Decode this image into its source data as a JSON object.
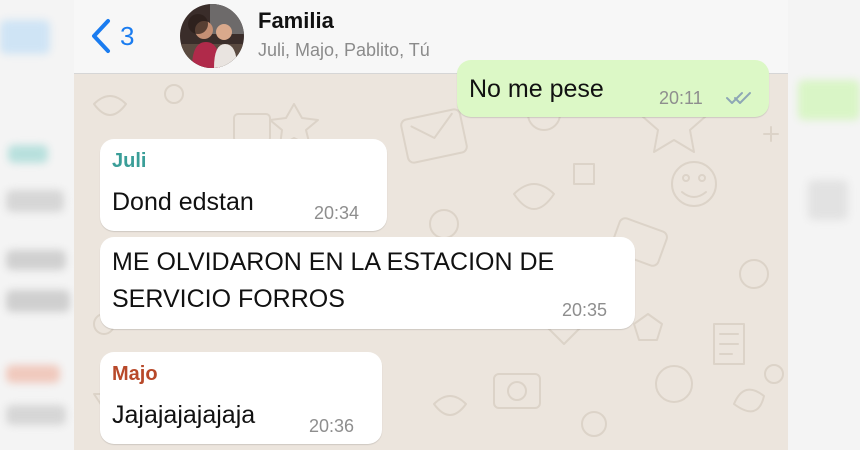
{
  "header": {
    "back_count": "3",
    "chat_title": "Familia",
    "members": "Juli, Majo, Pablito, Tú"
  },
  "colors": {
    "ios_blue": "#1a7cf0",
    "chat_background": "#ece5dd",
    "outgoing_bubble": "#dcf8c6",
    "incoming_bubble": "#ffffff",
    "juli_name": "#3a9e98",
    "majo_name": "#b8492a",
    "read_ticks": "#8ea7b5"
  },
  "messages": [
    {
      "direction": "outgoing",
      "text": "No me pese",
      "time": "20:11",
      "status": "read-double-check-icon"
    },
    {
      "direction": "incoming",
      "sender": "Juli",
      "text": "Dond edstan",
      "time": "20:34"
    },
    {
      "direction": "incoming",
      "line1": "ME OLVIDARON EN LA ESTACION DE",
      "line2": "SERVICIO FORROS",
      "time": "20:35"
    },
    {
      "direction": "incoming",
      "sender": "Majo",
      "text": "Jajajajajajaja",
      "time": "20:36"
    }
  ]
}
